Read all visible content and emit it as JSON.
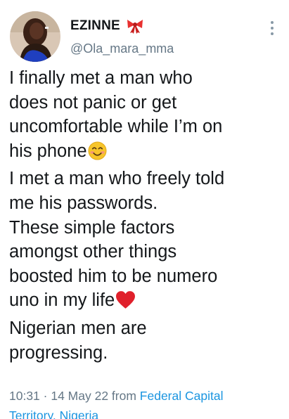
{
  "tweet": {
    "display_name": "EZINNE",
    "badge_icon": "ribbon-bow-icon",
    "handle": "@Ola_mara_mma",
    "text_lines": [
      "I finally met a man who",
      "does not panic or get",
      "uncomfortable while I’m on",
      "his phone",
      "I met a man who freely told",
      "me his passwords.",
      "These simple factors",
      "amongst other things",
      "boosted him to be numero",
      "uno in my life",
      "Nigerian men are",
      "progressing."
    ],
    "emojis": {
      "after_line_4": "smiling-face-icon",
      "after_line_10": "red-heart-icon"
    },
    "timestamp": "10:31 · 14 May 22 from ",
    "location_line1": "Federal Capital",
    "location_line2": "Territory, Nigeria"
  },
  "colors": {
    "text": "#14171a",
    "secondary": "#657786",
    "link": "#1b95e0",
    "heart": "#e0202b",
    "emoji_face": "#f7c52b",
    "ribbon": "#e8302f"
  }
}
